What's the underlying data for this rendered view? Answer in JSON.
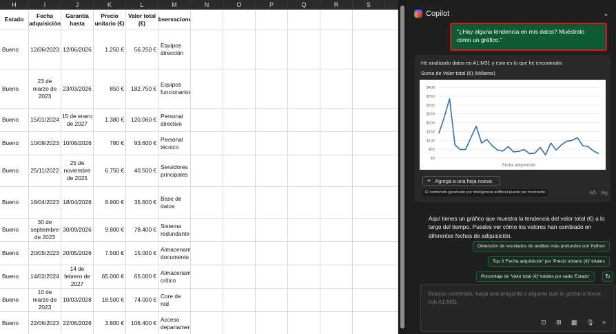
{
  "sheet": {
    "columns": [
      "H",
      "I",
      "J",
      "K",
      "L",
      "M",
      "N",
      "O",
      "P",
      "Q",
      "R",
      "S"
    ],
    "headers": {
      "estado": "Estado",
      "fecha": "Fecha adquisición",
      "garantia": "Garantía hasta",
      "precio": "Precio unitario (€)",
      "valor": "Valor total (€)",
      "obs": "Observaciones"
    },
    "rows": [
      {
        "estado": "Bueno",
        "fecha": "12/06/2023",
        "garantia": "12/06/2026",
        "precio": "1.250 €",
        "valor": "56.250 €",
        "obs": "Equipos dirección"
      },
      {
        "estado": "Bueno",
        "fecha": "23 de marzo de 2023",
        "garantia": "23/03/2026",
        "precio": "850 €",
        "valor": "182.750 €",
        "obs": "Equipos funcionarios"
      },
      {
        "estado": "Bueno",
        "fecha": "15/01/2024",
        "garantia": "15 de enero de 2027",
        "precio": "1.380 €",
        "valor": "120.060 €",
        "obs": "Personal directivo"
      },
      {
        "estado": "Bueno",
        "fecha": "10/08/2023",
        "garantia": "10/08/2026",
        "precio": "780 €",
        "valor": "93.600 €",
        "obs": "Personal técnico"
      },
      {
        "estado": "Bueno",
        "fecha": "25/11/2022",
        "garantia": "25 de noviembre de 2025",
        "precio": "6.750 €",
        "valor": "40.500 €",
        "obs": "Servidores principales"
      },
      {
        "estado": "Bueno",
        "fecha": "18/04/2023",
        "garantia": "18/04/2026",
        "precio": "8.900 €",
        "valor": "35.600 €",
        "obs": "Base de datos"
      },
      {
        "estado": "Bueno",
        "fecha": "30 de septiembre de 2023",
        "garantia": "30/09/2026",
        "precio": "9.800 €",
        "valor": "78.400 €",
        "obs": "Sistema redundante"
      },
      {
        "estado": "Bueno",
        "fecha": "20/05/2023",
        "garantia": "20/05/2026",
        "precio": "7.500 €",
        "valor": "15.000 €",
        "obs": "Almacenamiento documento"
      },
      {
        "estado": "Bueno",
        "fecha": "14/02/2024",
        "garantia": "14 de febrero de 2027",
        "precio": "65.000 €",
        "valor": "65.000 €",
        "obs": "Almacenamiento crítico"
      },
      {
        "estado": "Bueno",
        "fecha": "10 de marzo de 2023",
        "garantia": "10/03/2028",
        "precio": "18.500 €",
        "valor": "74.000 €",
        "obs": "Core de red"
      },
      {
        "estado": "Bueno",
        "fecha": "22/06/2023",
        "garantia": "22/06/2026",
        "precio": "3.800 €",
        "valor": "106.400 €",
        "obs": "Acceso departamental"
      }
    ]
  },
  "copilot": {
    "title": "Copilot",
    "user_message": "\"¿Hay alguna tendencia en mis datos? Muéstralo como un gráfico.\"",
    "analysis_intro": "He analizado datos en A1:M31 y esto es lo que he encontrado:",
    "chart_title": "Suma de Valor total (€) (Millares)",
    "add_sheet_label": "Agrega a una hoja nueva",
    "ai_disclaimer": "El contenido generado por inteligencia artificial puede ser incorrecto",
    "response_text": "Aquí tienes un gráfico que muestra la tendencia del valor total (€) a lo largo del tiempo. Puedes ver cómo los valores han cambiado en diferentes fechas de adquisición.",
    "suggestions": [
      "Obtención de resultados de análisis más profundos con Python",
      "Top 3 'Fecha adquisición' por 'Precio unitario (€)' totales",
      "Porcentaje de 'Valor total (€)' totales por cada 'Estado'"
    ],
    "input_placeholder": "Busque contenido, haga una pregunta o dígame qué le gustaría hacer con A1:M31",
    "colors": {
      "accent_green": "#0e5a33",
      "highlight_red": "#e0141e",
      "line_blue": "#2e6fb0"
    }
  },
  "chart_data": {
    "type": "line",
    "title": "Suma de Valor total (€) (Millares)",
    "xlabel": "Fecha adquisición",
    "ylabel": "",
    "ylim": [
      0,
      400
    ],
    "yticks": [
      "$0",
      "$50",
      "$100",
      "$150",
      "$200",
      "$250",
      "$300",
      "$350",
      "$400"
    ],
    "series": [
      {
        "values": [
          140,
          230,
          335,
          75,
          48,
          48,
          115,
          180,
          85,
          105,
          70,
          45,
          40,
          65,
          35,
          38,
          48,
          25,
          28,
          60,
          18,
          85,
          45,
          75,
          95,
          100,
          115,
          70,
          65,
          40,
          25
        ]
      }
    ]
  }
}
